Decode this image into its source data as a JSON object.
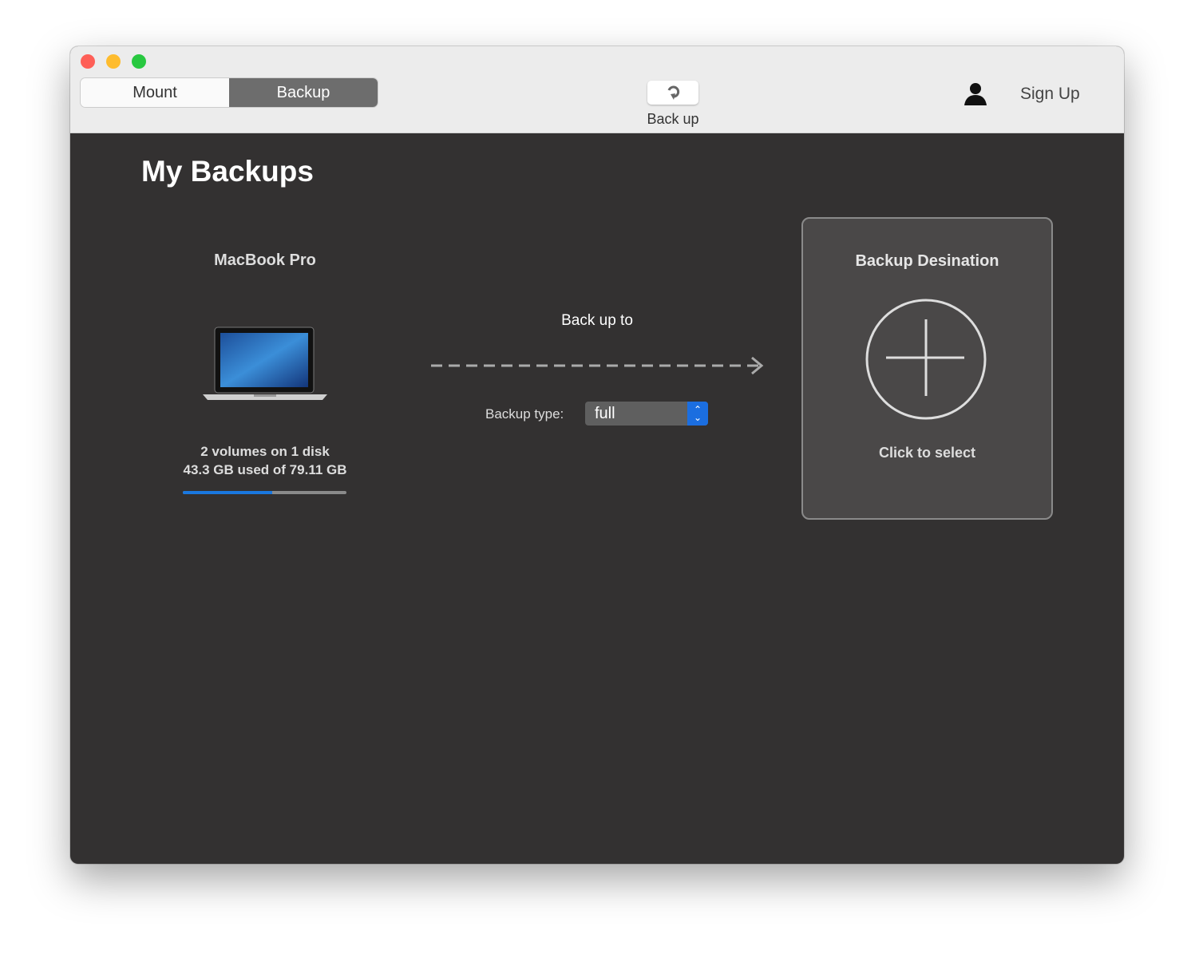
{
  "toolbar": {
    "tabs": [
      {
        "label": "Mount",
        "active": false
      },
      {
        "label": "Backup",
        "active": true
      }
    ],
    "backup_button_label": "Back up",
    "sign_up_label": "Sign Up"
  },
  "main": {
    "title": "My Backups",
    "source": {
      "name": "MacBook Pro",
      "volumes": "2 volumes on 1 disk",
      "usage": "43.3 GB used of 79.11 GB",
      "used_fraction": 0.547
    },
    "backup_to_label": "Back up to",
    "backup_type_label": "Backup type:",
    "backup_type_value": "full",
    "destination": {
      "title": "Backup Desination",
      "action": "Click to select"
    }
  },
  "colors": {
    "accent": "#1a78e0",
    "background": "#333131"
  }
}
